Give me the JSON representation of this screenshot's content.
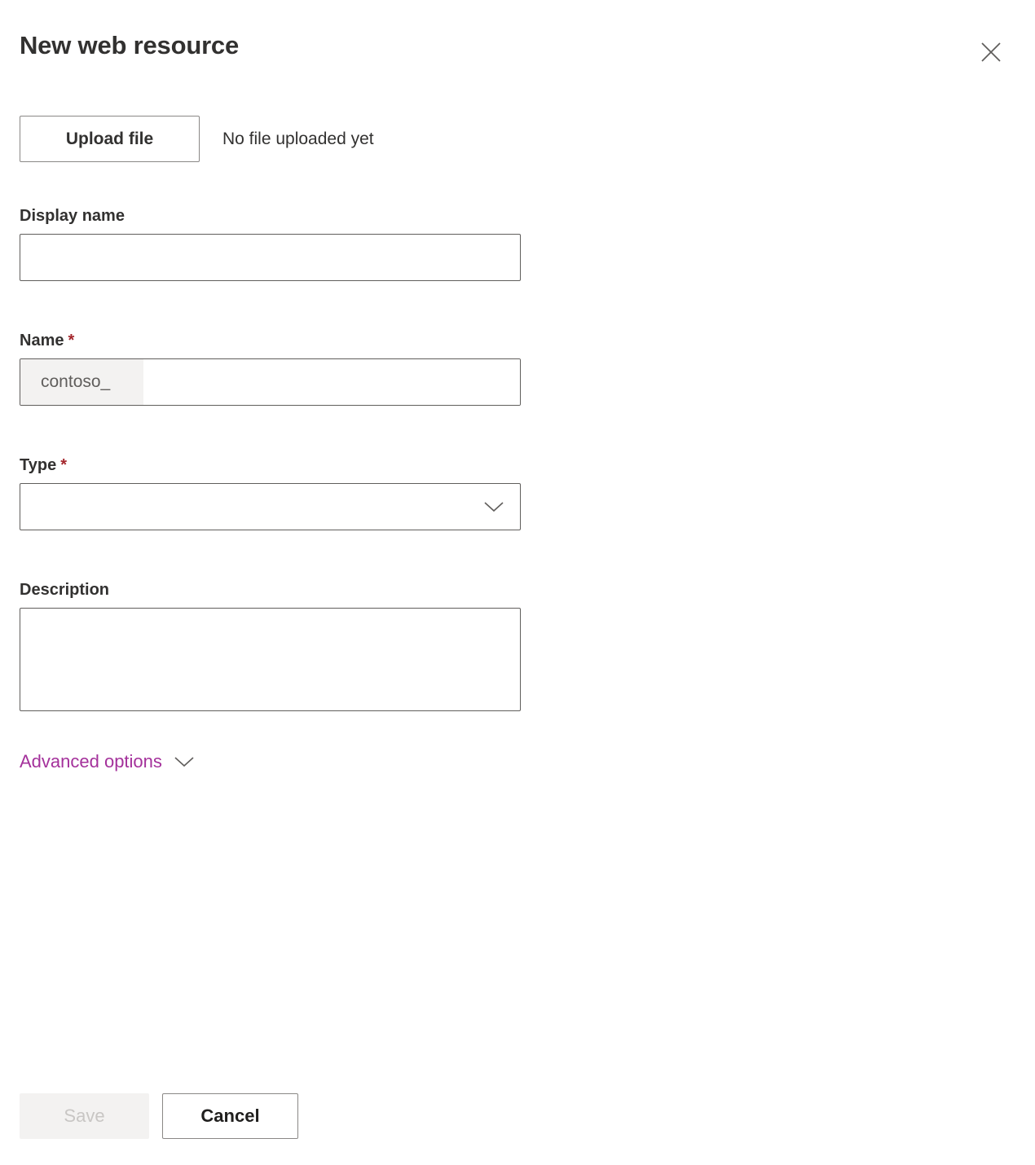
{
  "dialog": {
    "title": "New web resource",
    "close_icon": "close-icon"
  },
  "upload": {
    "button_label": "Upload file",
    "status_text": "No file uploaded yet"
  },
  "fields": {
    "display_name": {
      "label": "Display name",
      "value": "",
      "placeholder": ""
    },
    "name": {
      "label": "Name",
      "required_marker": "*",
      "prefix": "contoso_",
      "value": "",
      "placeholder": ""
    },
    "type": {
      "label": "Type",
      "required_marker": "*",
      "value": "",
      "chevron_icon": "chevron-down-icon"
    },
    "description": {
      "label": "Description",
      "value": "",
      "placeholder": ""
    }
  },
  "advanced_options": {
    "label": "Advanced options",
    "chevron_icon": "chevron-down-icon"
  },
  "footer": {
    "save_label": "Save",
    "cancel_label": "Cancel"
  },
  "colors": {
    "accent_purple": "#a4319b",
    "required_red": "#a4262c",
    "text_primary": "#323130",
    "border": "#605e5c",
    "disabled_bg": "#f3f2f1",
    "disabled_text": "#c8c6c4"
  }
}
